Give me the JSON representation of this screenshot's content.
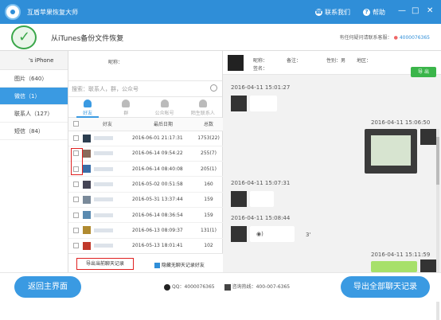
{
  "window": {
    "title": "互盾苹果恢复大师",
    "contact_label": "联系我们",
    "help_label": "帮助",
    "minimize": "—",
    "maximize": "□",
    "close": "✕"
  },
  "header": {
    "title": "从iTunes备份文件恢复",
    "support_text": "有任何疑问请联系客服：",
    "support_phone": "4000076365"
  },
  "sidebar": {
    "device": "'s iPhone",
    "items": [
      {
        "label": "图片（640）"
      },
      {
        "label": "微信（1）"
      },
      {
        "label": "联系人（127）"
      },
      {
        "label": "短信（84）"
      }
    ]
  },
  "contacts": {
    "nickname_label": "昵称：",
    "search_placeholder": "搜索：联系人，群，公众号",
    "tabs": [
      {
        "label": "好友"
      },
      {
        "label": "群"
      },
      {
        "label": "公众帐号"
      },
      {
        "label": "陌生联系人"
      }
    ],
    "columns": [
      "好友",
      "最后日期",
      "总数"
    ],
    "rows": [
      {
        "date": "2016-06-01 21:17:31",
        "count": "1753(22)"
      },
      {
        "date": "2016-06-14 09:54:22",
        "count": "255(7)"
      },
      {
        "date": "2016-06-14 08:40:08",
        "count": "205(1)"
      },
      {
        "date": "2016-05-02 00:51:58",
        "count": "160"
      },
      {
        "date": "2016-05-31 13:37:44",
        "count": "159"
      },
      {
        "date": "2016-06-14 08:36:54",
        "count": "159"
      },
      {
        "date": "2016-06-13 08:09:37",
        "count": "131(1)"
      },
      {
        "date": "2016-05-13 18:01:41",
        "count": "102"
      }
    ],
    "export_button": "导出当前聊天记录",
    "hide_checkbox": "隐藏无聊天记录好友"
  },
  "chat": {
    "nickname_label": "昵称：",
    "remark_label": "备注：",
    "gender_label": "性别：",
    "gender_value": "男",
    "region_label": "地区：",
    "signature_label": "签名：",
    "green_button": "导 出",
    "messages": [
      {
        "time": "2016-04-11 15:01:27"
      },
      {
        "time": "2016-04-11 15:06:50"
      },
      {
        "time": "2016-04-11 15:07:31"
      },
      {
        "time": "2016-04-11 15:08:44"
      },
      {
        "voice": "3'"
      },
      {
        "time": "2016-04-11 15:11:59"
      }
    ]
  },
  "footer": {
    "back_button": "返回主界面",
    "qq_label": "QQ：",
    "qq_value": "4000076365",
    "phone_label": "咨询热线：",
    "phone_value": "400-007-6365",
    "export_all_button": "导出全部聊天记录"
  },
  "colors": {
    "titlebar": "#2f8ed8",
    "accent": "#3a9ae2",
    "highlight": "#e02020",
    "green": "#3ab54a"
  }
}
